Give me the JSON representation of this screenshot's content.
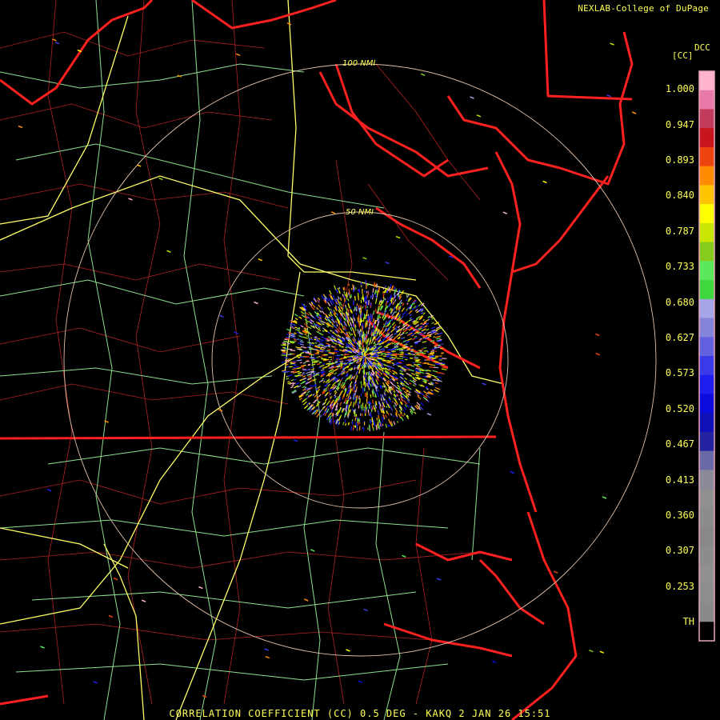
{
  "header": {
    "credit": "NEXLAB-College of DuPage",
    "product_code": "DCC",
    "units": "[CC]"
  },
  "range_rings": [
    {
      "label": "100 NMI"
    },
    {
      "label": "50 NMI"
    }
  ],
  "legend": {
    "labels": [
      "1.000",
      "0.947",
      "0.893",
      "0.840",
      "0.787",
      "0.733",
      "0.680",
      "0.627",
      "0.573",
      "0.520",
      "0.467",
      "0.413",
      "0.360",
      "0.307",
      "0.253",
      "TH"
    ],
    "colors": [
      "#ffb3cf",
      "#e77aa9",
      "#c23b5c",
      "#c8141c",
      "#ee4410",
      "#ff8c00",
      "#ffc400",
      "#ffff00",
      "#c8e600",
      "#86cc1e",
      "#5be85b",
      "#3ed83e",
      "#a5a5e8",
      "#8484d8",
      "#6262e0",
      "#3a3ae8",
      "#1e1eee",
      "#0c0cde",
      "#1010b8",
      "#2424a2",
      "#6a6aa8",
      "#8a8a9a",
      "#909090",
      "#8c8c8c",
      "#888888",
      "#8c8c8c",
      "#909090",
      "#8e8e8e",
      "#8a8a8a",
      "#000000"
    ],
    "bar_border_color": "#e7a6b8"
  },
  "colors": {
    "state_lines": "#ff2020",
    "county_lines": "#b22222",
    "highways": "#ffff66",
    "roads": "#8ee08e",
    "range_ring": "#e0c0a8"
  },
  "caption": "CORRELATION COEFFICIENT (CC) 0.5 DEG - KAKQ 2 JAN 26 15:51"
}
